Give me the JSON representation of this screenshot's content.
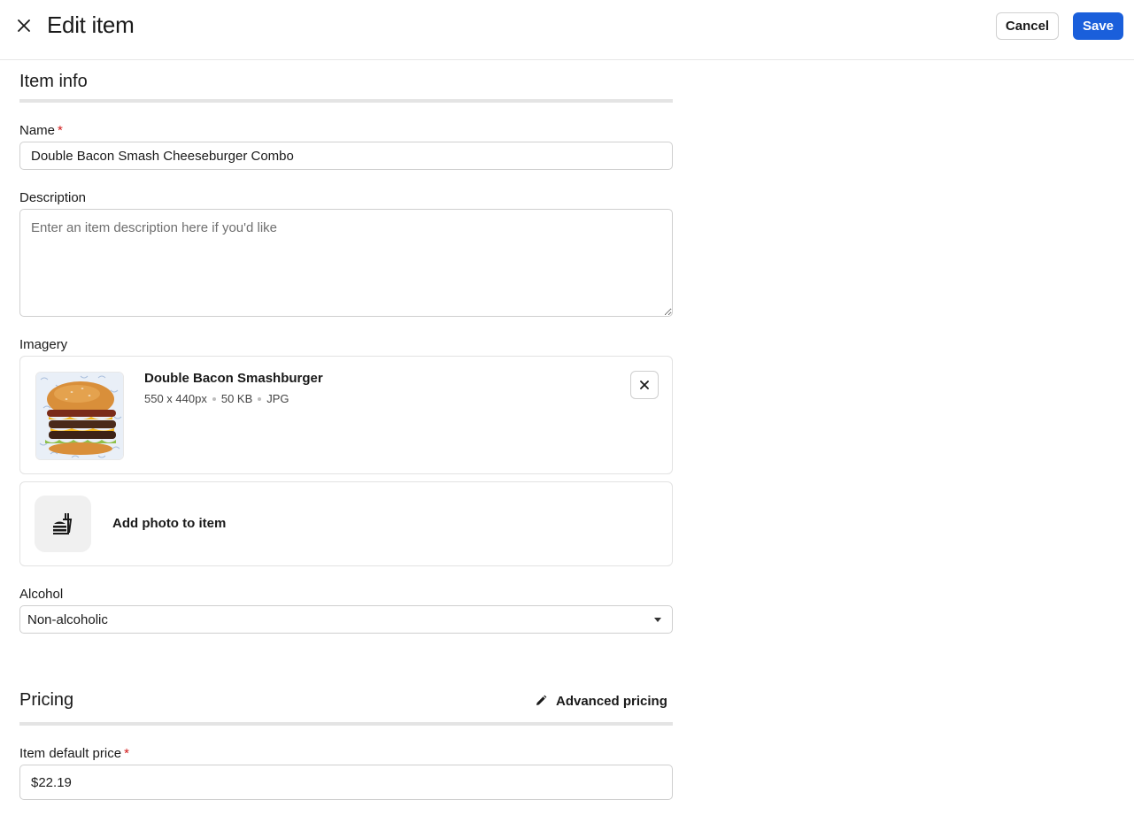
{
  "header": {
    "title": "Edit item",
    "cancel_label": "Cancel",
    "save_label": "Save",
    "primary_color": "#1a5fdb"
  },
  "item_info": {
    "section_title": "Item info",
    "name_label": "Name",
    "name_value": "Double Bacon Smash Cheeseburger Combo",
    "description_label": "Description",
    "description_value": "",
    "description_placeholder": "Enter an item description here if you'd like",
    "imagery_label": "Imagery",
    "image": {
      "name": "Double Bacon Smashburger",
      "dimensions": "550 x 440px",
      "size": "50 KB",
      "format": "JPG"
    },
    "add_photo_label": "Add photo to item",
    "alcohol_label": "Alcohol",
    "alcohol_value": "Non-alcoholic"
  },
  "pricing": {
    "section_title": "Pricing",
    "advanced_pricing_label": "Advanced pricing",
    "default_price_label": "Item default price",
    "default_price_value": "$22.19"
  },
  "required_marker": "*",
  "icons": {
    "close": "close-icon",
    "remove": "close-icon",
    "add_photo": "food-icon",
    "edit": "pencil-icon",
    "caret": "caret-down-icon"
  }
}
